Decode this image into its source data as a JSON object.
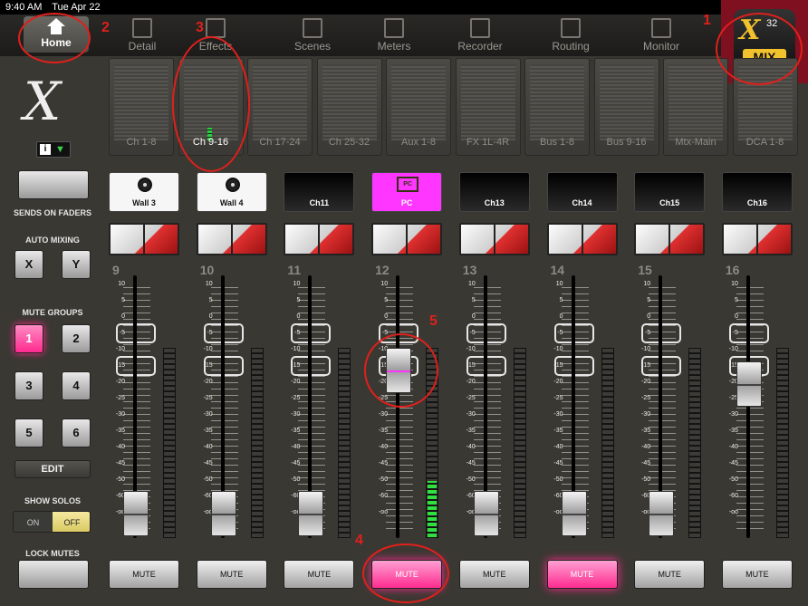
{
  "status": {
    "time": "9:40 AM",
    "date": "Tue Apr 22"
  },
  "nav": {
    "tabs": [
      {
        "label": "Home",
        "icon": "home-icon"
      },
      {
        "label": "Detail",
        "icon": "detail-icon"
      },
      {
        "label": "Effects",
        "icon": "effects-icon"
      },
      {
        "label": "Scenes",
        "icon": "scenes-icon"
      },
      {
        "label": "Meters",
        "icon": "meters-icon"
      },
      {
        "label": "Recorder",
        "icon": "recorder-icon"
      },
      {
        "label": "Routing",
        "icon": "routing-icon"
      },
      {
        "label": "Monitor",
        "icon": "monitor-icon"
      }
    ]
  },
  "logo": {
    "brand_x": "X",
    "brand_num": "32",
    "brand_mix": "MIX"
  },
  "banks": [
    "Ch 1-8",
    "Ch 9-16",
    "Ch 17-24",
    "Ch 25-32",
    "Aux 1-8",
    "FX 1L-4R",
    "Bus 1-8",
    "Bus 9-16",
    "Mtx-Main",
    "DCA 1-8"
  ],
  "active_bank": 1,
  "left": {
    "info": "i",
    "sends_on_faders": "SENDS ON FADERS",
    "auto_mixing": "AUTO MIXING",
    "auto_x": "X",
    "auto_y": "Y",
    "mute_groups": "MUTE GROUPS",
    "groups": [
      "1",
      "2",
      "3",
      "4",
      "5",
      "6"
    ],
    "active_group": "1",
    "edit": "EDIT",
    "show_solos": "SHOW SOLOS",
    "solo_on": "ON",
    "solo_off": "OFF",
    "lock_mutes": "LOCK MUTES"
  },
  "scale": [
    "10",
    "5",
    "0",
    "-5",
    "-10",
    "-15",
    "-20",
    "-25",
    "-30",
    "-35",
    "-40",
    "-45",
    "-50",
    "-60",
    "-oo"
  ],
  "channels": [
    {
      "number": "9",
      "name": "Wall 3",
      "style": "white",
      "icon": "mic",
      "mute": "MUTE",
      "muted": false,
      "fader": 0.05,
      "meter": 0
    },
    {
      "number": "10",
      "name": "Wall 4",
      "style": "white",
      "icon": "mic",
      "mute": "MUTE",
      "muted": false,
      "fader": 0.05,
      "meter": 0
    },
    {
      "number": "11",
      "name": "Ch11",
      "style": "black",
      "icon": "",
      "mute": "MUTE",
      "muted": false,
      "fader": 0.05,
      "meter": 0
    },
    {
      "number": "12",
      "name": "PC",
      "style": "pink",
      "icon": "pc",
      "pc_text": "PC",
      "mute": "MUTE",
      "muted": true,
      "fader": 0.68,
      "meter": 0.3
    },
    {
      "number": "13",
      "name": "Ch13",
      "style": "black",
      "icon": "",
      "mute": "MUTE",
      "muted": false,
      "fader": 0.05,
      "meter": 0
    },
    {
      "number": "14",
      "name": "Ch14",
      "style": "black",
      "icon": "",
      "mute": "MUTE",
      "muted": true,
      "fader": 0.05,
      "meter": 0
    },
    {
      "number": "15",
      "name": "Ch15",
      "style": "black",
      "icon": "",
      "mute": "MUTE",
      "muted": false,
      "fader": 0.05,
      "meter": 0
    },
    {
      "number": "16",
      "name": "Ch16",
      "style": "black",
      "icon": "",
      "mute": "MUTE",
      "muted": false,
      "fader": 0.62,
      "meter": 0
    }
  ],
  "annotations": [
    "1",
    "2",
    "3",
    "4",
    "5"
  ]
}
